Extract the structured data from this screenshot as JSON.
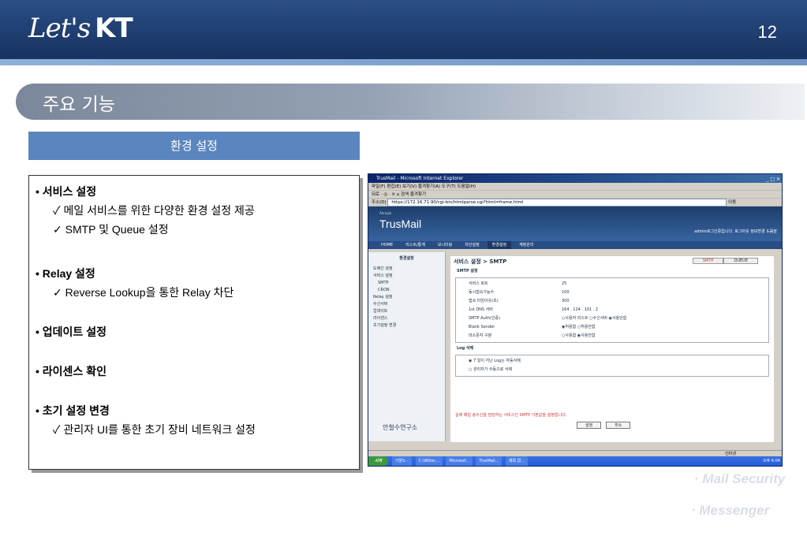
{
  "header": {
    "logo_script": "Let's",
    "logo_brand": "KT",
    "page_number": "12"
  },
  "section": {
    "title": "주요 기능"
  },
  "subheading": "환경 설정",
  "features": [
    {
      "title": "서비스 설정",
      "items": [
        "메일 서비스를 위한 다양한 환경 설정 제공",
        "SMTP 및 Queue 설정"
      ]
    },
    {
      "title": "Relay 설정",
      "items": [
        "Reverse Lookup을 통한 Relay 차단"
      ]
    },
    {
      "title": "업데이트 설정",
      "items": []
    },
    {
      "title": "라이센스 확인",
      "items": []
    },
    {
      "title": "초기 설정 변경",
      "items": [
        "관리자 UI를 통한 초기 장비 네트워크 설정"
      ]
    }
  ],
  "check_mark": "✓",
  "bullet_mark": "•",
  "screenshot": {
    "window_title": "TrusMail - Microsoft Internet Explorer",
    "menu": "파일(F)  편집(E)  보기(V)  즐겨찾기(A)  도구(T)  도움말(H)",
    "toolbar": "뒤로 · ◎ · ✕ ⌂  검색  즐겨찾기",
    "address_label": "주소(D)",
    "address": "https://172.16.71.90/cgi-bin/htmlparse.cgi?html=frame.html",
    "go": "이동",
    "app_sub": "AhnLab",
    "app_name": "TrusMail",
    "user_info": "admin로그인중입니다.  로그아웃  정보변경  도움말",
    "nav": [
      "HOME",
      "리스트/통계",
      "모니터링",
      "차단설정",
      "환경설정",
      "계정관리"
    ],
    "side_title": "환경설정",
    "side_items": [
      "도메인 설정",
      "서비스 설정",
      "SMTP",
      "CRON",
      "Relay 설정",
      "수신서버",
      "업데이트",
      "라이센스",
      "초기설정 변경"
    ],
    "brand": "안철수연구소",
    "breadcrumb": "서비스 설정 > SMTP",
    "tabs": [
      "SMTP",
      "QUEUE"
    ],
    "smtp_header": "SMTP 설정",
    "rows": [
      {
        "label": "서비스 포트",
        "value": "25"
      },
      {
        "label": "동시접속가능수",
        "value": "100"
      },
      {
        "label": "접속 타임아웃(초)",
        "value": "300"
      },
      {
        "label": "1st DNS 서버",
        "value": "164 . 124 . 101 . 2"
      },
      {
        "label": "SMTP Auth(인증)",
        "value": "○사용자 리스트  ○수신서버  ◉사용안함"
      },
      {
        "label": "Blank Sender",
        "value": "◉허용함  ○허용안함"
      },
      {
        "label": "대소문자 구분",
        "value": "○사용함  ◉사용안함"
      }
    ],
    "log_header": "Log 삭제",
    "log_rows": [
      "◉ 7 일이 지난 Log는 자동삭제",
      "○ 관리자가 수동으로 삭제"
    ],
    "note": "실제 메일 송수신을 담당하는 서비스인 SMTP 기본값을 설정합니다.",
    "buttons": [
      "설정",
      "취소"
    ],
    "status": "인터넷",
    "taskbar_start": "시작",
    "taskbar_items": [
      "가양노 -",
      "C:\\WDoc...",
      "Microsof...",
      "TrusMail...",
      "제목 없..."
    ],
    "clock": "오후 6:04"
  },
  "watermarks": [
    "· Mail Security",
    "· Messenger"
  ]
}
